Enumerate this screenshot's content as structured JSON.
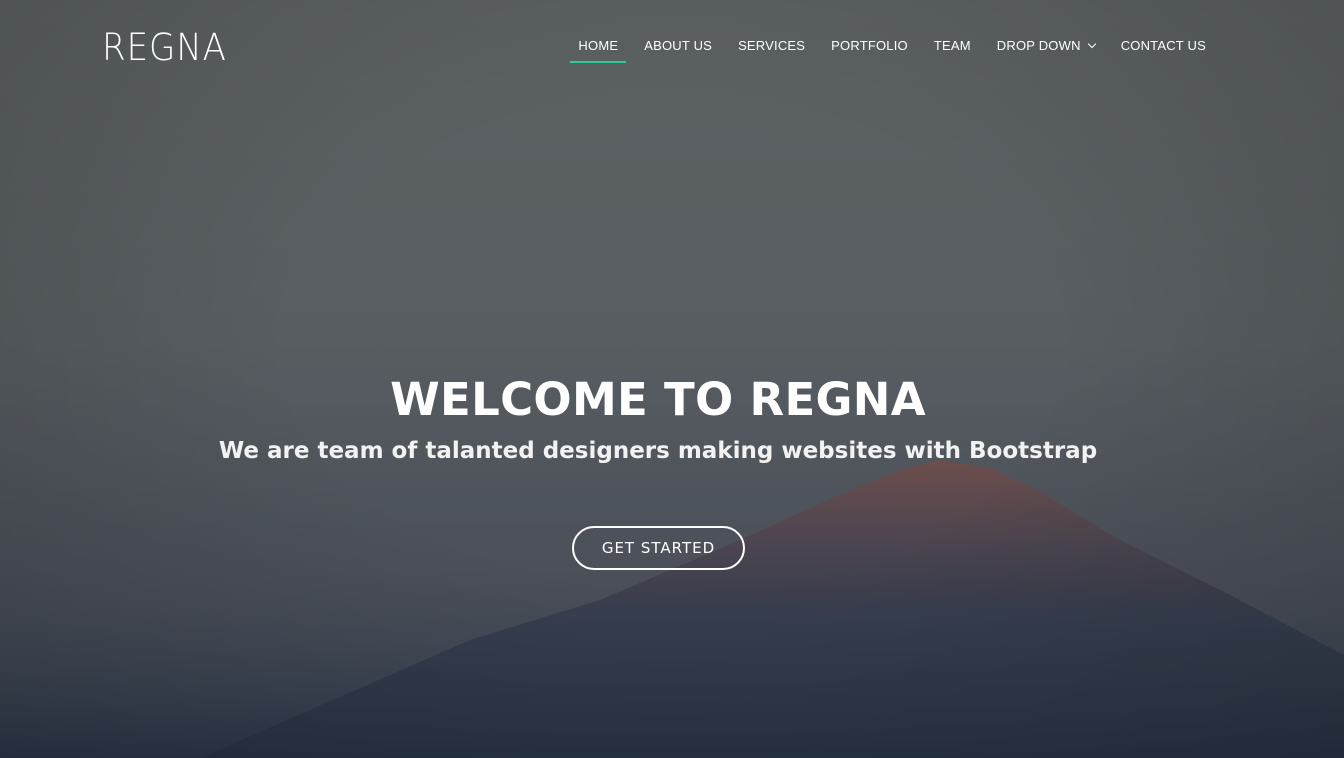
{
  "brand": {
    "logo_text": "REGNA"
  },
  "nav": {
    "items": [
      {
        "label": "HOME",
        "active": true
      },
      {
        "label": "ABOUT US",
        "active": false
      },
      {
        "label": "SERVICES",
        "active": false
      },
      {
        "label": "PORTFOLIO",
        "active": false
      },
      {
        "label": "TEAM",
        "active": false
      },
      {
        "label": "DROP DOWN",
        "active": false,
        "has_dropdown": true
      },
      {
        "label": "CONTACT US",
        "active": false
      }
    ]
  },
  "hero": {
    "title": "WELCOME TO REGNA",
    "subtitle": "We are team of talanted designers making websites with Bootstrap",
    "cta_label": "GET STARTED"
  },
  "colors": {
    "accent": "#2dc997",
    "text": "#ffffff"
  }
}
